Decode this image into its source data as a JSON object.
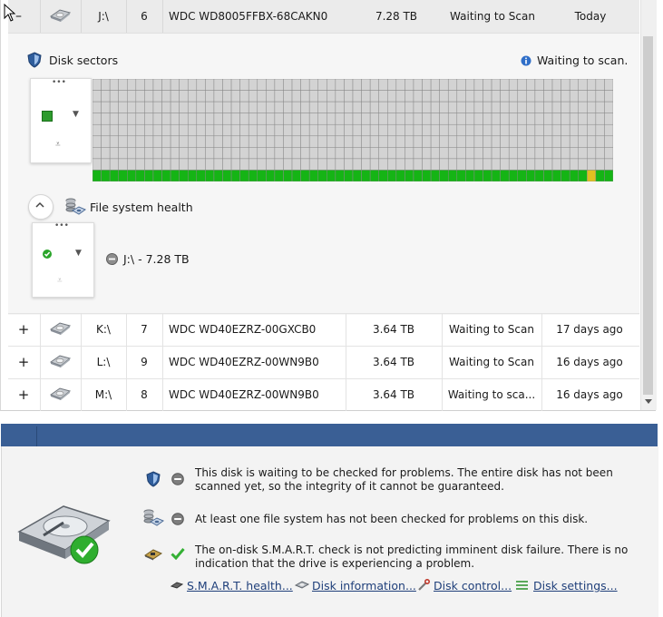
{
  "disks": [
    {
      "toggle": "–",
      "drive": "J:\\",
      "num": "6",
      "model": "WDC WD8005FFBX-68CAKN0",
      "size": "7.28 TB",
      "status": "Waiting to Scan",
      "last": "Today"
    },
    {
      "toggle": "+",
      "drive": "K:\\",
      "num": "7",
      "model": "WDC WD40EZRZ-00GXCB0",
      "size": "3.64 TB",
      "status": "Waiting to Scan",
      "last": "17 days ago"
    },
    {
      "toggle": "+",
      "drive": "L:\\",
      "num": "9",
      "model": "WDC WD40EZRZ-00WN9B0",
      "size": "3.64 TB",
      "status": "Waiting to Scan",
      "last": "16 days ago"
    },
    {
      "toggle": "+",
      "drive": "M:\\",
      "num": "8",
      "model": "WDC WD40EZRZ-00WN9B0",
      "size": "3.64 TB",
      "status": "Waiting to sca...",
      "last": "16 days ago"
    }
  ],
  "sectors": {
    "title": "Disk sectors",
    "status": "Waiting to scan.",
    "grid": {
      "cols": 60,
      "rows": 9,
      "scanned_rows": 1,
      "yellow_cols": [
        57
      ],
      "colors": {
        "unscanned": "#d3d3d3",
        "ok": "#15b415",
        "yellow": "#e0c020",
        "line": "#888888"
      }
    }
  },
  "fs": {
    "title": "File system health",
    "volume": "J:\\ - 7.28 TB"
  },
  "controls": {
    "more": "•••",
    "dropdown": "▼",
    "filter": "⩡"
  },
  "bottom": {
    "messages": [
      "This disk is waiting to be checked for problems. The entire disk has not been scanned yet, so the integrity of it cannot be guaranteed.",
      "At least one file system has not been checked for problems on this disk.",
      "The on-disk S.M.A.R.T. check is not predicting imminent disk failure. There is no indication that the drive is experiencing a problem."
    ],
    "links": {
      "smart": "S.M.A.R.T. health...",
      "info": "Disk information...",
      "control": "Disk control...",
      "settings": "Disk settings..."
    }
  },
  "colors": {
    "header_bar": "#3a5f95",
    "selected_row": "#ebebeb",
    "link": "#1f3f7a"
  }
}
